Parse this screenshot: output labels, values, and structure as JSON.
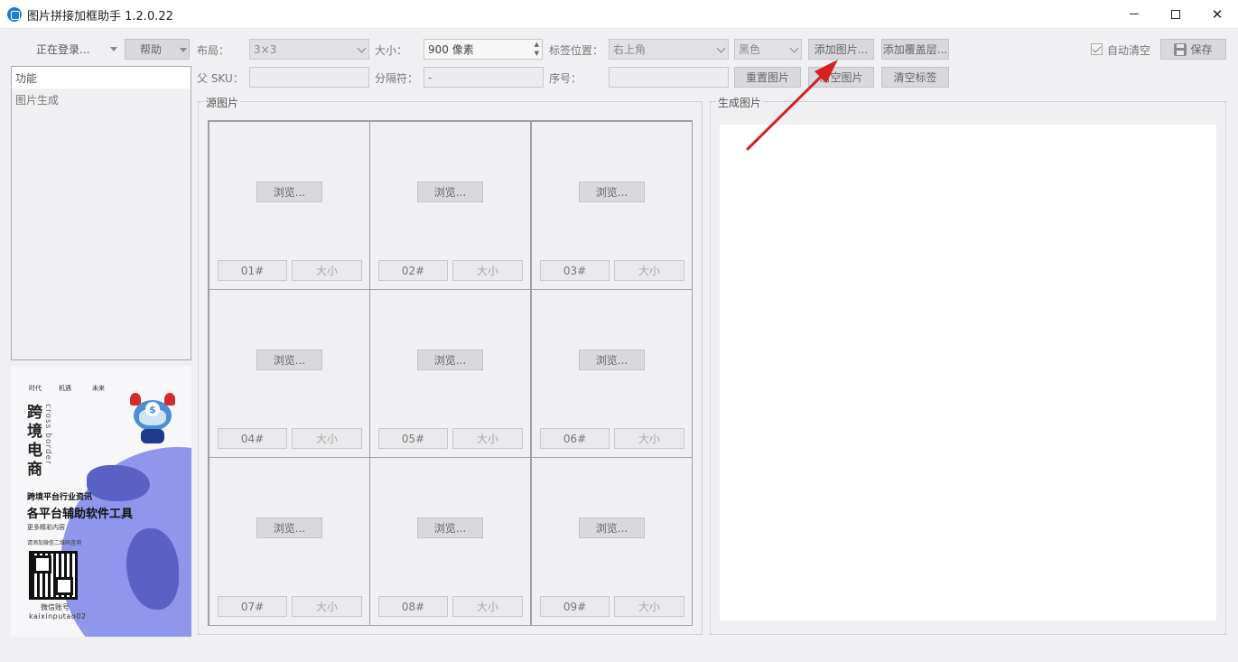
{
  "window": {
    "title": "图片拼接加框助手 1.2.0.22"
  },
  "toolbar": {
    "login_label": "正在登录...",
    "help_label": "帮助",
    "layout_label": "布局：",
    "layout_value": "3×3",
    "size_label": "大小：",
    "size_value": "900 像素",
    "tag_position_label": "标签位置：",
    "tag_position_value": "右上角",
    "color_value": "黑色",
    "add_image_label": "添加图片...",
    "add_overlay_label": "添加覆盖层...",
    "auto_clear_label": "自动清空",
    "auto_clear_checked": true,
    "save_label": "保存",
    "parent_sku_label": "父 SKU：",
    "parent_sku_value": "",
    "separator_label": "分隔符：",
    "separator_value": "-",
    "serial_label": "序号：",
    "serial_value": "",
    "reset_image_label": "重置图片",
    "clear_image_label": "清空图片",
    "clear_tags_label": "清空标签"
  },
  "sidebar": {
    "items": [
      {
        "label": "功能",
        "selected": true
      },
      {
        "label": "图片生成",
        "selected": false
      }
    ]
  },
  "ad": {
    "top_words": [
      "时代",
      "机遇",
      "未来"
    ],
    "big_title": [
      "跨",
      "境",
      "电",
      "商"
    ],
    "cross_text": "cross border",
    "line1": "跨境平台行业资讯",
    "line2": "各平台辅助软件工具",
    "line3": "更多精彩内容",
    "line4": "请添加微信二维码咨询",
    "wechat_label": "微信账号",
    "wechat_id": "kaixinputao02",
    "mascot_symbol": "$"
  },
  "source": {
    "title": "源图片",
    "cells": [
      {
        "browse": "浏览...",
        "number": "01#",
        "size": "大小"
      },
      {
        "browse": "浏览...",
        "number": "02#",
        "size": "大小"
      },
      {
        "browse": "浏览...",
        "number": "03#",
        "size": "大小"
      },
      {
        "browse": "浏览...",
        "number": "04#",
        "size": "大小"
      },
      {
        "browse": "浏览...",
        "number": "05#",
        "size": "大小"
      },
      {
        "browse": "浏览...",
        "number": "06#",
        "size": "大小"
      },
      {
        "browse": "浏览...",
        "number": "07#",
        "size": "大小"
      },
      {
        "browse": "浏览...",
        "number": "08#",
        "size": "大小"
      },
      {
        "browse": "浏览...",
        "number": "09#",
        "size": "大小"
      }
    ]
  },
  "output": {
    "title": "生成图片"
  },
  "colors": {
    "annotation_arrow": "#d42222"
  }
}
